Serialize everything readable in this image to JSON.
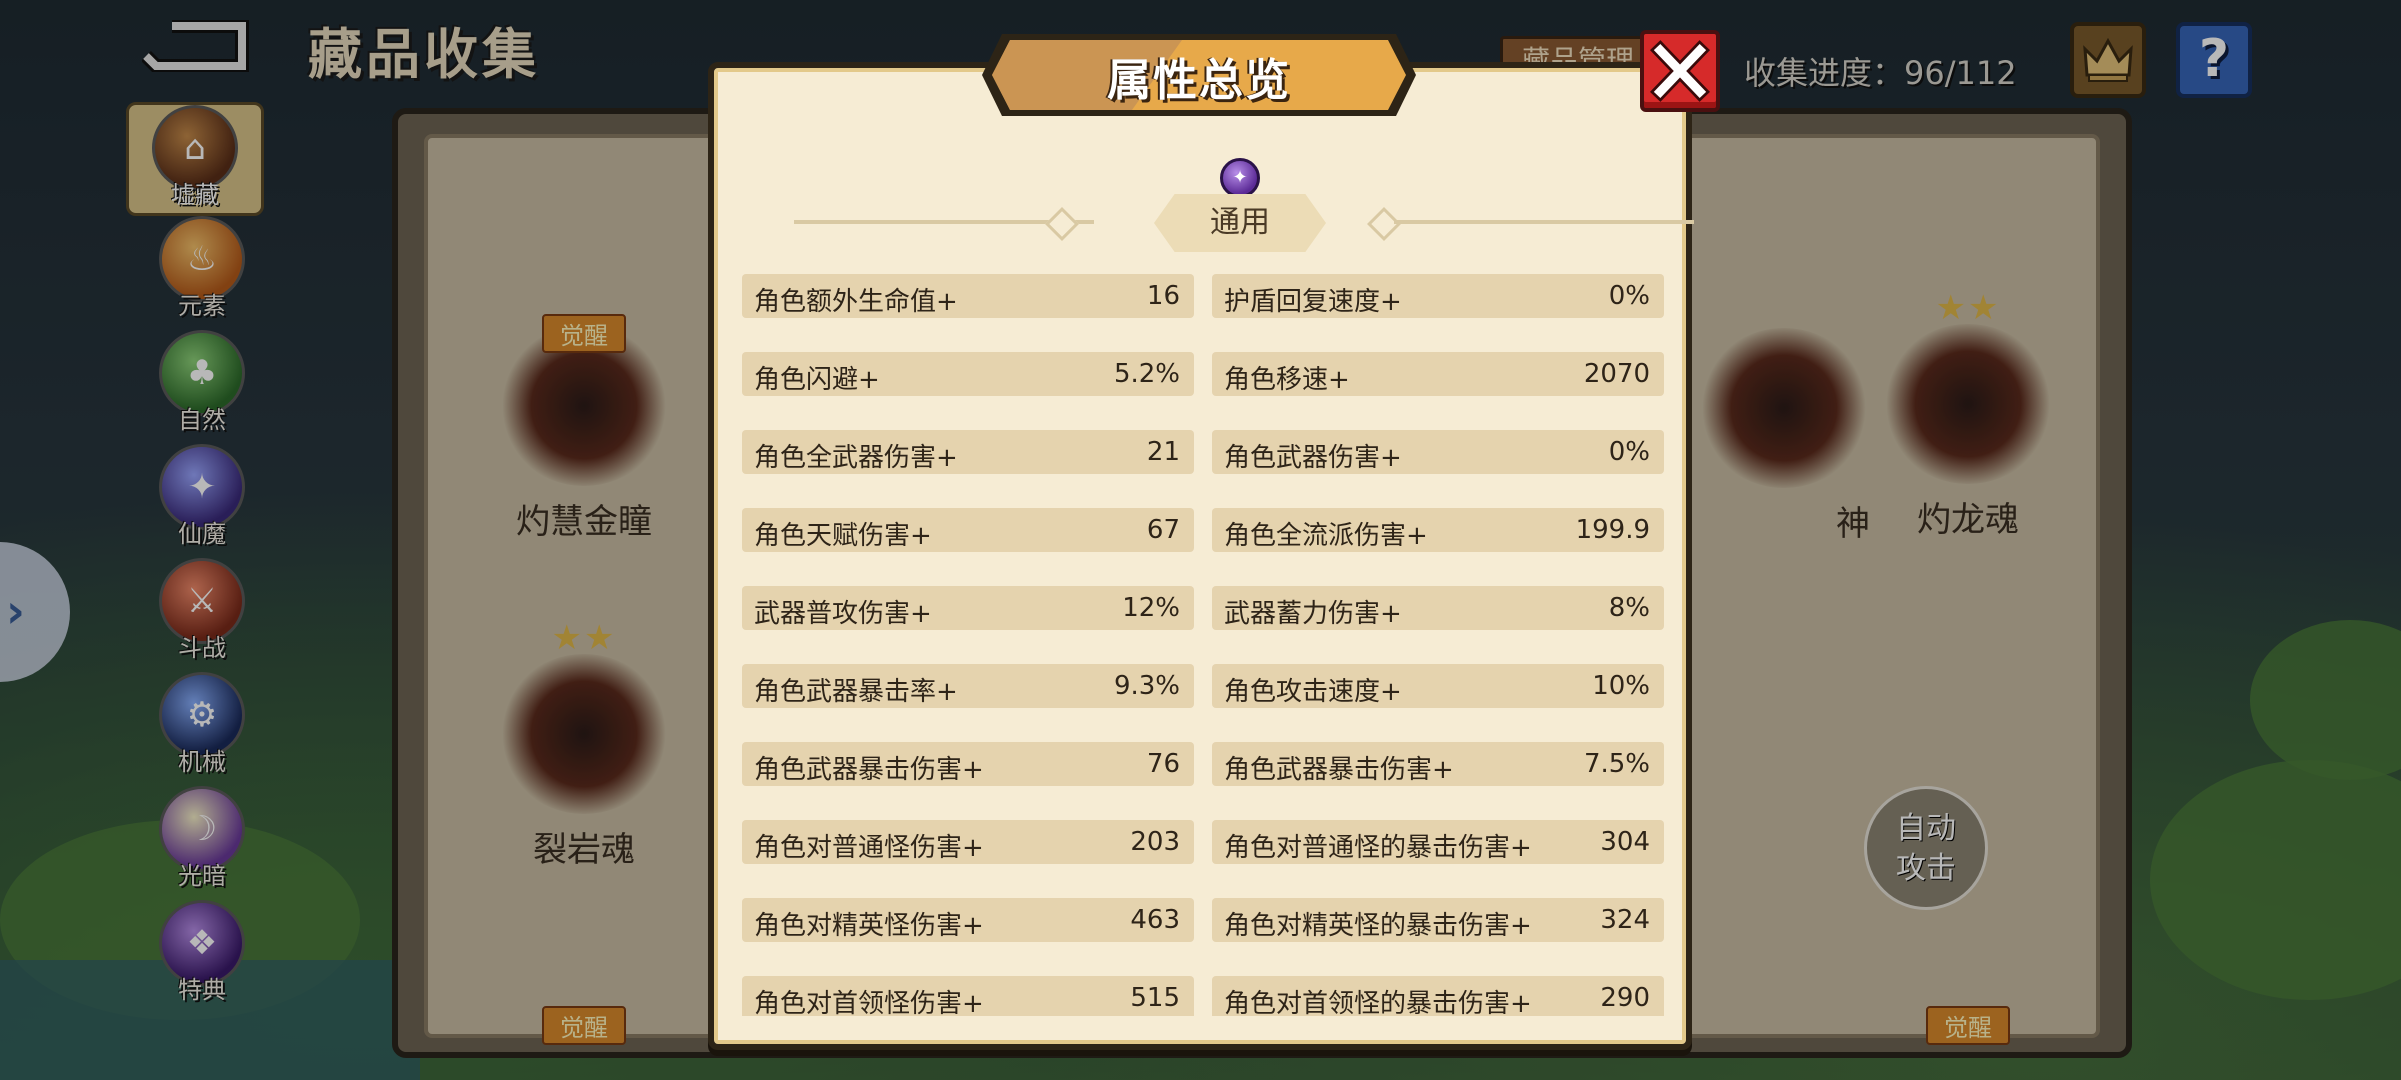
{
  "header": {
    "title": "藏品收集",
    "manage_label": "藏品管理",
    "progress_label": "收集进度：",
    "progress_value": "96/112"
  },
  "sidebar": {
    "items": [
      {
        "label": "墟藏",
        "icon": "helmet-icon",
        "active": true
      },
      {
        "label": "元素",
        "icon": "fire-icon"
      },
      {
        "label": "自然",
        "icon": "tree-icon"
      },
      {
        "label": "仙魔",
        "icon": "spirit-icon"
      },
      {
        "label": "斗战",
        "icon": "war-icon"
      },
      {
        "label": "机械",
        "icon": "robot-icon"
      },
      {
        "label": "光暗",
        "icon": "light-dark-icon"
      },
      {
        "label": "特典",
        "icon": "special-icon"
      }
    ]
  },
  "collection": {
    "relics": [
      {
        "name": "灼慧金瞳",
        "badge": "觉醒"
      },
      {
        "name": "裂岩魂",
        "stars": "★★"
      },
      {
        "name": "神"
      },
      {
        "name": "灼龙魂",
        "stars": "★★"
      }
    ],
    "bottom_badges": [
      "觉醒",
      "觉醒"
    ]
  },
  "auto_attack": {
    "line1": "自动",
    "line2": "攻击"
  },
  "modal": {
    "title": "属性总览",
    "section": "通用",
    "stats": [
      {
        "key": "角色额外生命值+",
        "value": "16"
      },
      {
        "key": "护盾回复速度+",
        "value": "0%"
      },
      {
        "key": "角色闪避+",
        "value": "5.2%"
      },
      {
        "key": "角色移速+",
        "value": "2070"
      },
      {
        "key": "角色全武器伤害+",
        "value": "21"
      },
      {
        "key": "角色武器伤害+",
        "value": "0%"
      },
      {
        "key": "角色天赋伤害+",
        "value": "67"
      },
      {
        "key": "角色全流派伤害+",
        "value": "199.9"
      },
      {
        "key": "武器普攻伤害+",
        "value": "12%"
      },
      {
        "key": "武器蓄力伤害+",
        "value": "8%"
      },
      {
        "key": "角色武器暴击率+",
        "value": "9.3%"
      },
      {
        "key": "角色攻击速度+",
        "value": "10%"
      },
      {
        "key": "角色武器暴击伤害+",
        "value": "76"
      },
      {
        "key": "角色武器暴击伤害+",
        "value": "7.5%"
      },
      {
        "key": "角色对普通怪伤害+",
        "value": "203"
      },
      {
        "key": "角色对普通怪的暴击伤害+",
        "value": "304"
      },
      {
        "key": "角色对精英怪伤害+",
        "value": "463"
      },
      {
        "key": "角色对精英怪的暴击伤害+",
        "value": "324"
      },
      {
        "key": "角色对首领怪伤害+",
        "value": "515"
      },
      {
        "key": "角色对首领怪的暴击伤害+",
        "value": "290"
      }
    ]
  }
}
